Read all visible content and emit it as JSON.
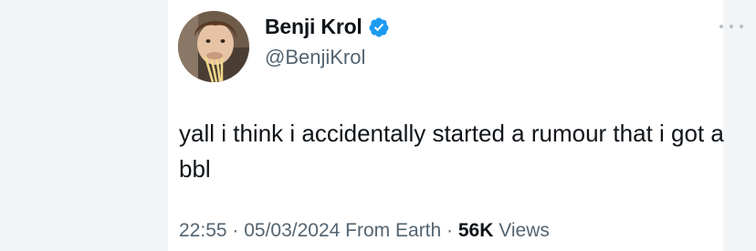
{
  "author": {
    "display_name": "Benji Krol",
    "handle": "@BenjiKrol",
    "avatar_icon": "profile-photo",
    "verified_icon": "verified-badge-icon",
    "verified_color": "#1d9bf0"
  },
  "tweet": {
    "text": "yall i think i accidentally started a rumour that i got a bbl"
  },
  "meta": {
    "time": "22:55",
    "separator1": " · ",
    "date": "05/03/2024",
    "source": " From Earth",
    "separator2": " · ",
    "views_count": "56K",
    "views_label": " Views"
  },
  "more_icon": "more-horizontal-icon"
}
